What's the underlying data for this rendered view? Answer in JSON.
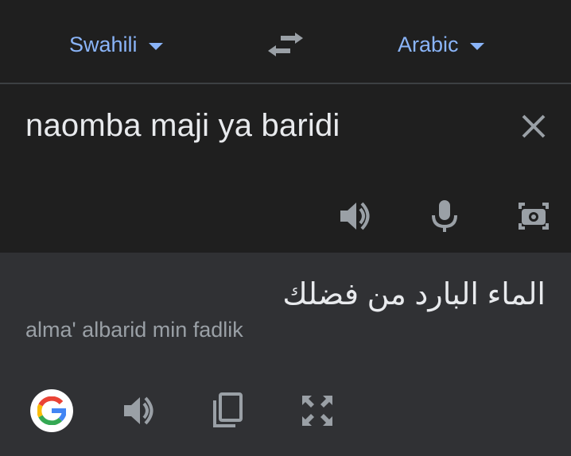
{
  "lang_bar": {
    "source_language": "Swahili",
    "target_language": "Arabic",
    "swap_icon": "swap-horiz-icon",
    "accent_color": "#8ab4f8"
  },
  "input": {
    "source_text": "naomba maji ya baridi",
    "clear_icon": "close-icon",
    "actions": [
      "speaker-icon",
      "microphone-icon",
      "camera-icon"
    ]
  },
  "output": {
    "translation": "الماء البارد من فضلك",
    "transliteration": "alma' albarid min fadlik",
    "actions": [
      "google-logo-icon",
      "speaker-icon",
      "copy-icon",
      "fullscreen-icon"
    ]
  }
}
